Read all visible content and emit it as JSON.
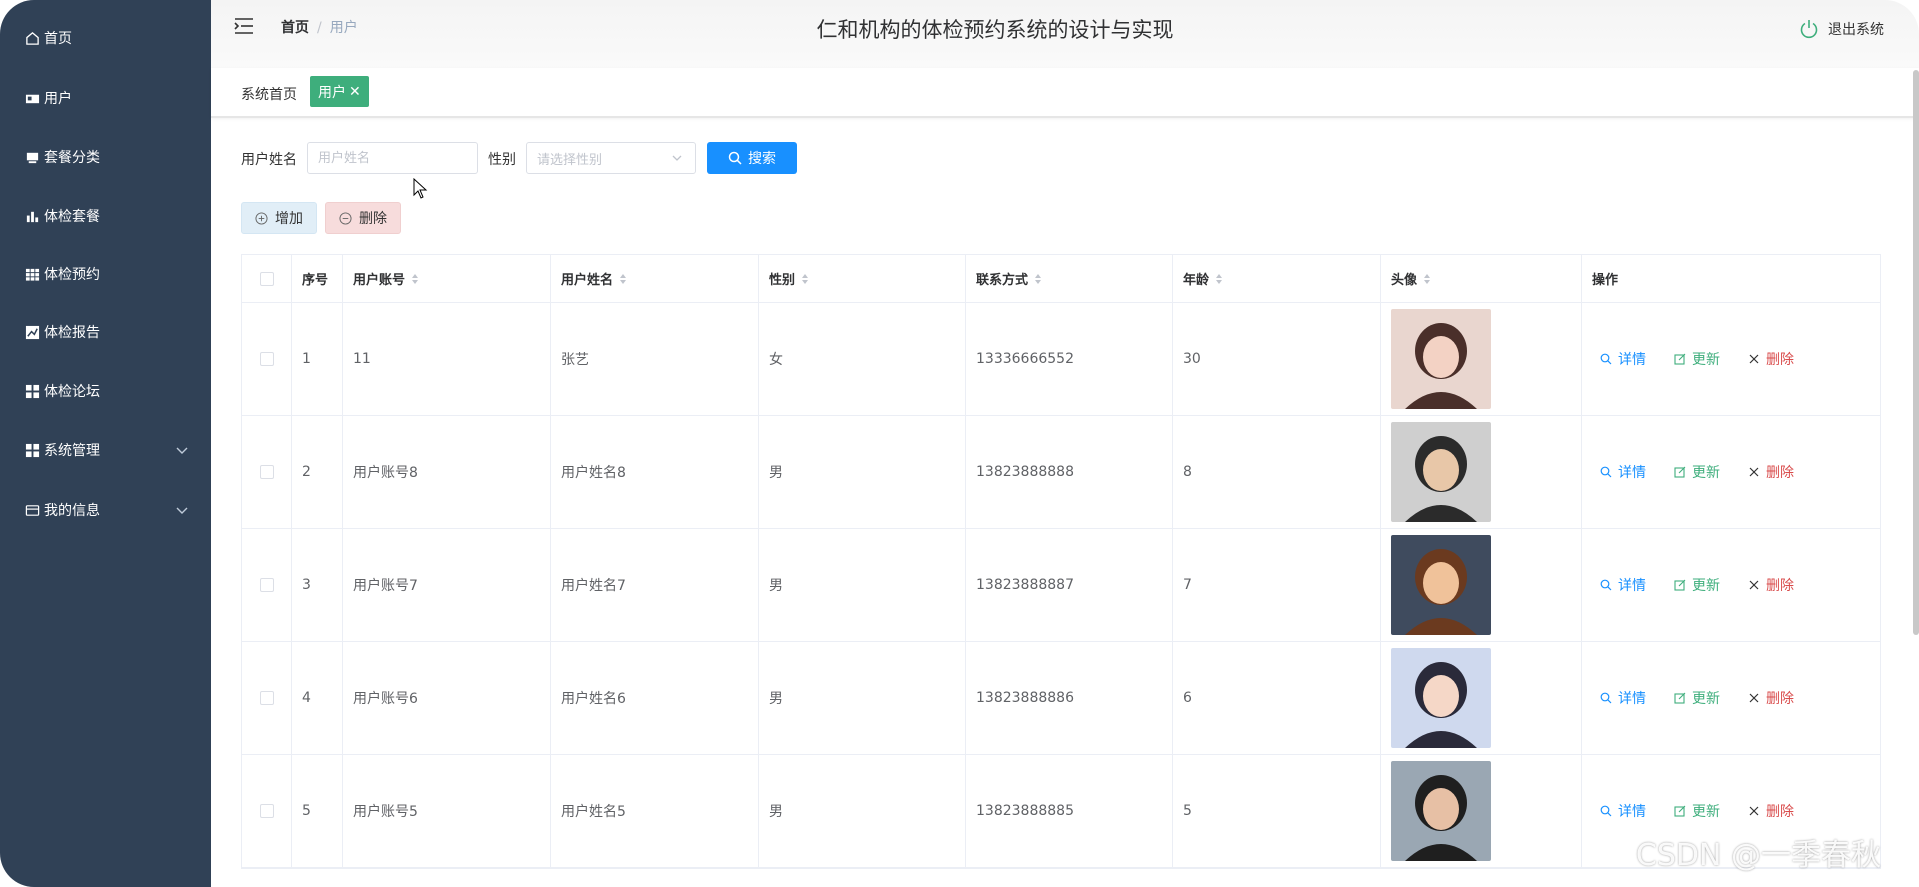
{
  "sidebar": {
    "items": [
      {
        "label": "首页",
        "icon": "home-icon"
      },
      {
        "label": "用户",
        "icon": "user-card-icon"
      },
      {
        "label": "套餐分类",
        "icon": "tray-icon"
      },
      {
        "label": "体检套餐",
        "icon": "bar-chart-icon"
      },
      {
        "label": "体检预约",
        "icon": "grid-icon"
      },
      {
        "label": "体检报告",
        "icon": "line-chart-icon"
      },
      {
        "label": "体检论坛",
        "icon": "apps-icon"
      },
      {
        "label": "系统管理",
        "icon": "apps-icon",
        "expandable": true
      },
      {
        "label": "我的信息",
        "icon": "credit-card-icon",
        "expandable": true
      }
    ]
  },
  "header": {
    "breadcrumb_home": "首页",
    "breadcrumb_current": "用户",
    "title": "仁和机构的体检预约系统的设计与实现",
    "logout_label": "退出系统"
  },
  "tags": {
    "home": "系统首页",
    "active": "用户",
    "active_close": "✕"
  },
  "search": {
    "name_label": "用户姓名",
    "name_placeholder": "用户姓名",
    "gender_label": "性别",
    "gender_placeholder": "请选择性别",
    "search_button": "搜索"
  },
  "toolbar": {
    "add_label": "增加",
    "delete_label": "删除"
  },
  "table": {
    "headers": {
      "index": "序号",
      "account": "用户账号",
      "name": "用户姓名",
      "gender": "性别",
      "phone": "联系方式",
      "age": "年龄",
      "avatar": "头像",
      "actions": "操作"
    },
    "action_labels": {
      "detail": "详情",
      "update": "更新",
      "remove": "删除"
    },
    "rows": [
      {
        "index": "1",
        "account": "11",
        "name": "张艺",
        "gender": "女",
        "phone": "13336666552",
        "age": "30"
      },
      {
        "index": "2",
        "account": "用户账号8",
        "name": "用户姓名8",
        "gender": "男",
        "phone": "13823888888",
        "age": "8"
      },
      {
        "index": "3",
        "account": "用户账号7",
        "name": "用户姓名7",
        "gender": "男",
        "phone": "13823888887",
        "age": "7"
      },
      {
        "index": "4",
        "account": "用户账号6",
        "name": "用户姓名6",
        "gender": "男",
        "phone": "13823888886",
        "age": "6"
      },
      {
        "index": "5",
        "account": "用户账号5",
        "name": "用户姓名5",
        "gender": "男",
        "phone": "13823888885",
        "age": "5"
      }
    ]
  },
  "watermark": "CSDN @一季春秋",
  "colors": {
    "sidebar_bg": "#304156",
    "primary": "#1890ff",
    "success": "#3eae7c",
    "danger": "#d94c4c"
  }
}
